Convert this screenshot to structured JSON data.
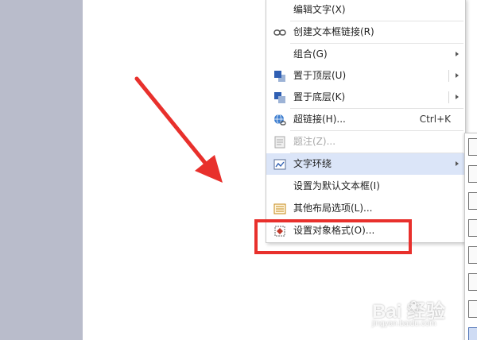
{
  "menu": {
    "items": [
      {
        "label": "编辑文字(X)",
        "icon": "none",
        "enabled": true,
        "submenu": false
      },
      {
        "label": "创建文本框链接(R)",
        "icon": "link-chain-icon",
        "enabled": true,
        "submenu": false
      },
      {
        "label": "组合(G)",
        "icon": "none",
        "enabled": true,
        "submenu": true
      },
      {
        "label": "置于顶层(U)",
        "icon": "bring-to-front-icon",
        "enabled": true,
        "submenu": true
      },
      {
        "label": "置于底层(K)",
        "icon": "send-to-back-icon",
        "enabled": true,
        "submenu": true
      },
      {
        "label": "超链接(H)...",
        "shortcut": "Ctrl+K",
        "icon": "hyperlink-globe-icon",
        "enabled": true,
        "submenu": false
      },
      {
        "label": "题注(Z)...",
        "icon": "caption-icon",
        "enabled": false,
        "submenu": false
      },
      {
        "label": "文字环绕",
        "icon": "text-wrap-icon",
        "enabled": true,
        "submenu": true,
        "highlighted": true
      },
      {
        "label": "设置为默认文本框(I)",
        "icon": "none",
        "enabled": true,
        "submenu": false
      },
      {
        "label": "其他布局选项(L)...",
        "icon": "layout-options-icon",
        "enabled": true,
        "submenu": false
      },
      {
        "label": "设置对象格式(O)...",
        "icon": "format-object-icon",
        "enabled": true,
        "submenu": false
      }
    ]
  },
  "watermark": {
    "brand": "Bai  经验",
    "url": "jingyan.baidu.com"
  },
  "colors": {
    "highlight": "#dbe5f8",
    "annotation_red": "#e8302c",
    "background": "#b9bccb"
  }
}
